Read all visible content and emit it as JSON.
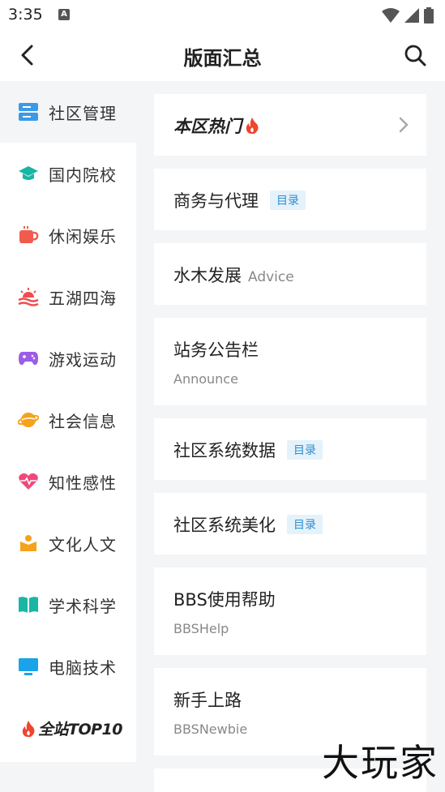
{
  "status": {
    "time": "3:35",
    "notification_icon": "A"
  },
  "header": {
    "title": "版面汇总"
  },
  "sidebar": {
    "items": [
      {
        "label": "社区管理",
        "icon": "server-icon",
        "color": "#3b9ae8"
      },
      {
        "label": "国内院校",
        "icon": "graduation-cap-icon",
        "color": "#19b6a4"
      },
      {
        "label": "休闲娱乐",
        "icon": "coffee-cup-icon",
        "color": "#f15b4e"
      },
      {
        "label": "五湖四海",
        "icon": "sunset-waves-icon",
        "color": "#f04e4e"
      },
      {
        "label": "游戏运动",
        "icon": "gamepad-icon",
        "color": "#9b5de5"
      },
      {
        "label": "社会信息",
        "icon": "planet-icon",
        "color": "#f6a21b"
      },
      {
        "label": "知性感性",
        "icon": "heart-pulse-icon",
        "color": "#f0487a"
      },
      {
        "label": "文化人文",
        "icon": "person-box-icon",
        "color": "#f6a21b"
      },
      {
        "label": "学术科学",
        "icon": "open-book-icon",
        "color": "#19b6a4"
      },
      {
        "label": "电脑技术",
        "icon": "monitor-icon",
        "color": "#1aa3e8"
      }
    ],
    "top10_label": "全站TOP10"
  },
  "boards": {
    "hot": {
      "title": "本区热门"
    },
    "items": [
      {
        "title": "商务与代理",
        "tag": "目录"
      },
      {
        "title": "水木发展",
        "subtitle": "Advice"
      },
      {
        "title": "站务公告栏",
        "subtitle": "Announce"
      },
      {
        "title": "社区系统数据",
        "tag": "目录"
      },
      {
        "title": "社区系统美化",
        "tag": "目录"
      },
      {
        "title": "BBS使用帮助",
        "subtitle": "BBSHelp"
      },
      {
        "title": "新手上路",
        "subtitle": "BBSNewbie"
      }
    ]
  },
  "watermark": "大玩家",
  "colors": {
    "accent_tag_text": "#2f8ed0",
    "accent_tag_bg": "#e4f2fb",
    "fire": "#f0452e"
  }
}
